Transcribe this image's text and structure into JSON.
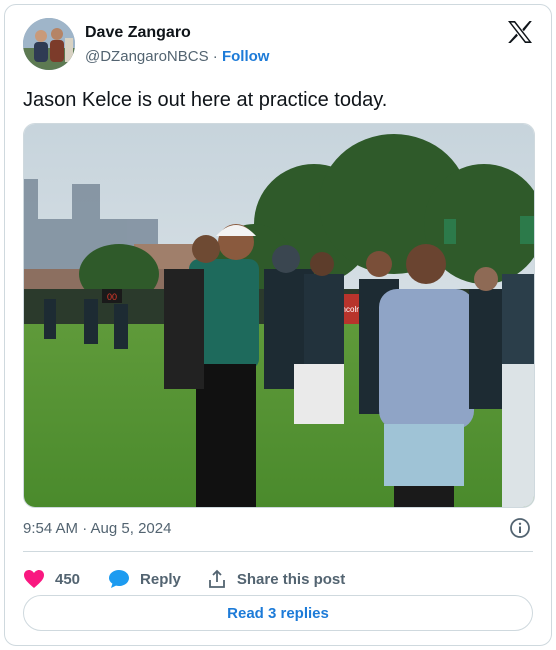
{
  "author": {
    "display_name": "Dave Zangaro",
    "handle": "@DZangaroNBCS",
    "separator": "·",
    "follow_label": "Follow"
  },
  "tweet": {
    "text": "Jason Kelce is out here at practice today.",
    "timestamp": "9:54 AM · Aug 5, 2024"
  },
  "media": {
    "scoreboard_text": "00",
    "banner_text": "Lincoln"
  },
  "actions": {
    "like_count": "450",
    "reply_label": "Reply",
    "share_label": "Share this post"
  },
  "read_replies_label": "Read 3 replies",
  "colors": {
    "like": "#f91880",
    "link": "#1d7bd8",
    "muted": "#536471",
    "border": "#cfd9de"
  },
  "icons": [
    "x-logo-icon",
    "info-icon",
    "heart-icon",
    "reply-bubble-icon",
    "share-icon"
  ]
}
